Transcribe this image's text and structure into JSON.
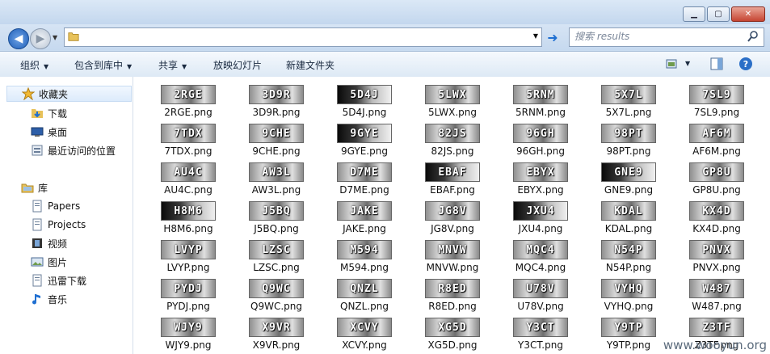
{
  "window": {
    "minimize_label": "▁",
    "maximize_label": "▢",
    "close_label": "✕"
  },
  "address": {
    "value": "",
    "search_placeholder": "搜索 results"
  },
  "toolbar": {
    "organize": "组织",
    "include_library": "包含到库中",
    "share": "共享",
    "slideshow": "放映幻灯片",
    "new_folder": "新建文件夹"
  },
  "sidebar": {
    "favorites": "收藏夹",
    "downloads": "下载",
    "desktop": "桌面",
    "recent": "最近访问的位置",
    "libraries": "库",
    "papers": "Papers",
    "projects": "Projects",
    "videos": "视频",
    "pictures": "图片",
    "thunder": "迅雷下载",
    "music": "音乐"
  },
  "files": [
    {
      "code": "2RGE",
      "name": "2RGE.png"
    },
    {
      "code": "3D9R",
      "name": "3D9R.png"
    },
    {
      "code": "5D4J",
      "name": "5D4J.png"
    },
    {
      "code": "5LWX",
      "name": "5LWX.png"
    },
    {
      "code": "5RNM",
      "name": "5RNM.png"
    },
    {
      "code": "5X7L",
      "name": "5X7L.png"
    },
    {
      "code": "7SL9",
      "name": "7SL9.png"
    },
    {
      "code": "7TDX",
      "name": "7TDX.png"
    },
    {
      "code": "9CHE",
      "name": "9CHE.png"
    },
    {
      "code": "9GYE",
      "name": "9GYE.png"
    },
    {
      "code": "82JS",
      "name": "82JS.png"
    },
    {
      "code": "96GH",
      "name": "96GH.png"
    },
    {
      "code": "98PT",
      "name": "98PT.png"
    },
    {
      "code": "AF6M",
      "name": "AF6M.png"
    },
    {
      "code": "AU4C",
      "name": "AU4C.png"
    },
    {
      "code": "AW3L",
      "name": "AW3L.png"
    },
    {
      "code": "D7ME",
      "name": "D7ME.png"
    },
    {
      "code": "EBAF",
      "name": "EBAF.png"
    },
    {
      "code": "EBYX",
      "name": "EBYX.png"
    },
    {
      "code": "GNE9",
      "name": "GNE9.png"
    },
    {
      "code": "GP8U",
      "name": "GP8U.png"
    },
    {
      "code": "H8M6",
      "name": "H8M6.png"
    },
    {
      "code": "J5BQ",
      "name": "J5BQ.png"
    },
    {
      "code": "JAKE",
      "name": "JAKE.png"
    },
    {
      "code": "JG8V",
      "name": "JG8V.png"
    },
    {
      "code": "JXU4",
      "name": "JXU4.png"
    },
    {
      "code": "KDAL",
      "name": "KDAL.png"
    },
    {
      "code": "KX4D",
      "name": "KX4D.png"
    },
    {
      "code": "LVYP",
      "name": "LVYP.png"
    },
    {
      "code": "LZSC",
      "name": "LZSC.png"
    },
    {
      "code": "M594",
      "name": "M594.png"
    },
    {
      "code": "MNVW",
      "name": "MNVW.png"
    },
    {
      "code": "MQC4",
      "name": "MQC4.png"
    },
    {
      "code": "N54P",
      "name": "N54P.png"
    },
    {
      "code": "PNVX",
      "name": "PNVX.png"
    },
    {
      "code": "PYDJ",
      "name": "PYDJ.png"
    },
    {
      "code": "Q9WC",
      "name": "Q9WC.png"
    },
    {
      "code": "QNZL",
      "name": "QNZL.png"
    },
    {
      "code": "R8ED",
      "name": "R8ED.png"
    },
    {
      "code": "U78V",
      "name": "U78V.png"
    },
    {
      "code": "VYHQ",
      "name": "VYHQ.png"
    },
    {
      "code": "W487",
      "name": "W487.png"
    },
    {
      "code": "WJY9",
      "name": "WJY9.png"
    },
    {
      "code": "X9VR",
      "name": "X9VR.png"
    },
    {
      "code": "XCVY",
      "name": "XCVY.png"
    },
    {
      "code": "XG5D",
      "name": "XG5D.png"
    },
    {
      "code": "Y3CT",
      "name": "Y3CT.png"
    },
    {
      "code": "Y9TP",
      "name": "Y9TP.png"
    },
    {
      "code": "Z3TF",
      "name": "Z3TF.png"
    }
  ],
  "watermark": "www.wooyun.org"
}
